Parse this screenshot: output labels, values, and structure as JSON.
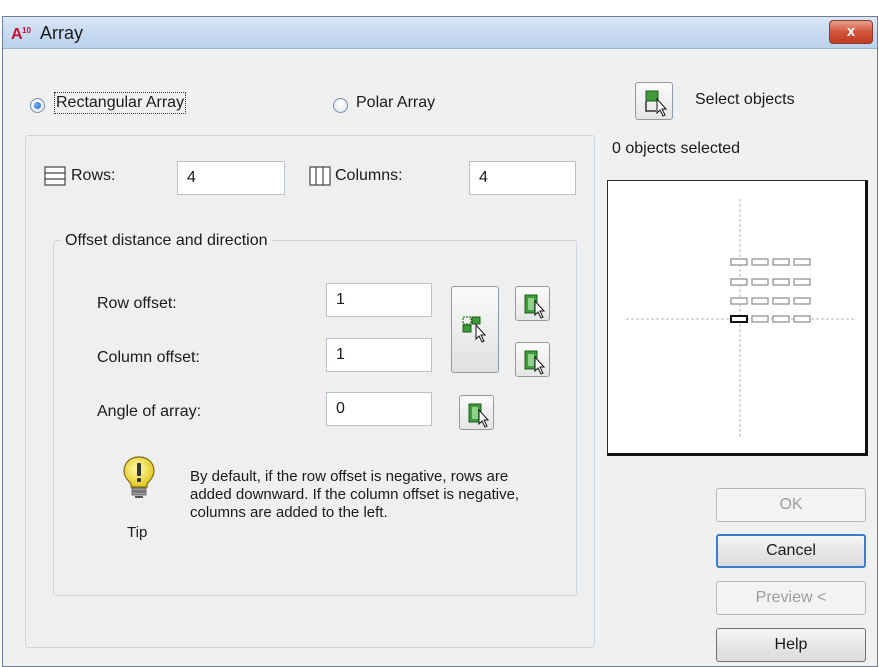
{
  "window": {
    "title": "Array",
    "app_icon": "autocad-a10-icon",
    "close_label": "x"
  },
  "array_type": {
    "rectangular_label": "Rectangular Array",
    "polar_label": "Polar Array",
    "selected": "rectangular"
  },
  "selection": {
    "select_label": "Select objects",
    "status": "0 objects selected"
  },
  "grid": {
    "rows_label": "Rows:",
    "rows_value": "4",
    "columns_label": "Columns:",
    "columns_value": "4"
  },
  "offset": {
    "group_title": "Offset distance and direction",
    "row_offset_label": "Row offset:",
    "row_offset_value": "1",
    "column_offset_label": "Column offset:",
    "column_offset_value": "1",
    "angle_label": "Angle of array:",
    "angle_value": "0"
  },
  "tip": {
    "label": "Tip",
    "text": "By default, if the row offset is negative, rows are added downward.  If the column offset is negative, columns are added to the left."
  },
  "buttons": {
    "ok": "OK",
    "cancel": "Cancel",
    "preview": "Preview <",
    "help": "Help"
  },
  "colors": {
    "title_gradient": "#c7daf0",
    "close_red": "#d0553b",
    "pick_green": "#3e9a3a",
    "radio_blue": "#1b5fbf"
  }
}
